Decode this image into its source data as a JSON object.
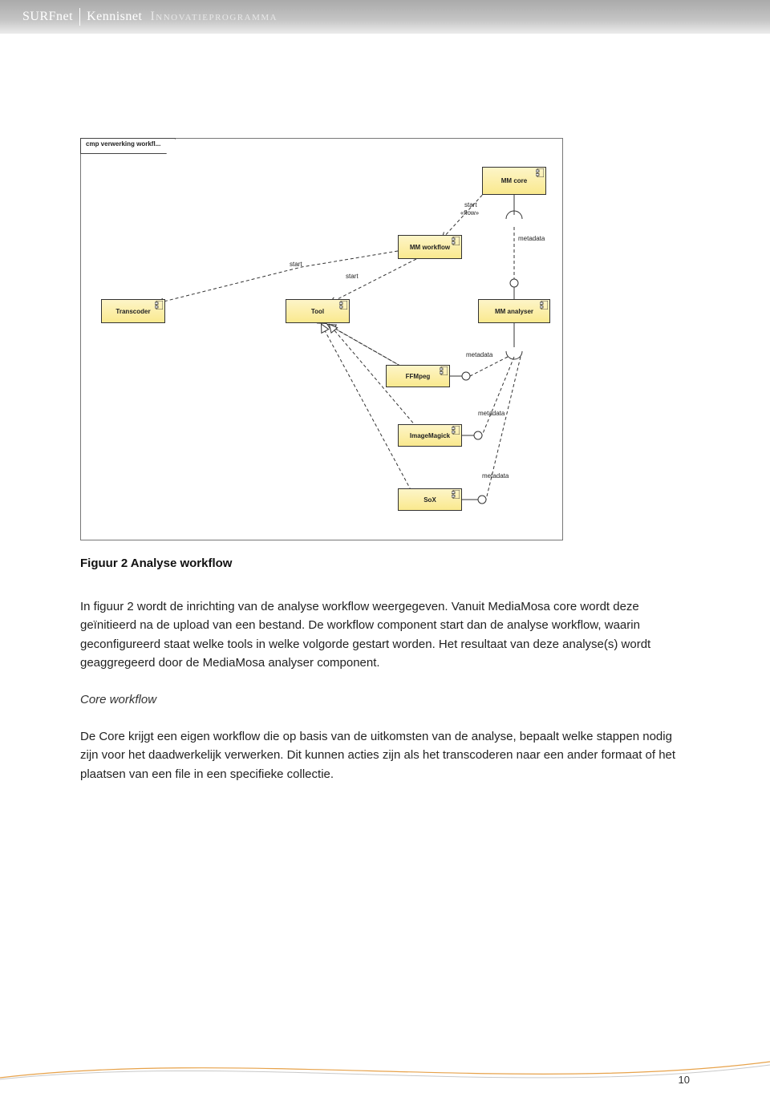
{
  "header": {
    "brand1": "SURFnet",
    "brand2": "Kennisnet",
    "program": "Innovatieprogramma"
  },
  "diagram": {
    "title_tab": "cmp verwerking workfl...",
    "components": {
      "mm_core": "MM core",
      "mm_workflow": "MM workflow",
      "transcoder": "Transcoder",
      "tool": "Tool",
      "mm_analyser": "MM analyser",
      "ffmpeg": "FFMpeg",
      "imagemagick": "ImageMagick",
      "sox": "SoX"
    },
    "labels": {
      "start_flow_1": "start",
      "start_flow_2": "«flow»",
      "start_a": "start",
      "start_b": "start",
      "metadata": "metadata"
    }
  },
  "body": {
    "caption": "Figuur 2 Analyse workflow",
    "para1": "In figuur 2 wordt de inrichting van de analyse workflow weergegeven. Vanuit MediaMosa core wordt deze geïnitieerd na de upload van een bestand. De workflow component start dan de analyse workflow, waarin geconfigureerd staat welke tools in welke volgorde gestart worden. Het resultaat van deze analyse(s) wordt geaggregeerd door de MediaMosa analyser component.",
    "sub1": "Core workflow",
    "para2": "De Core krijgt een eigen workflow die op basis van de uitkomsten van de analyse, bepaalt welke stappen nodig zijn voor het daadwerkelijk verwerken. Dit kunnen acties zijn als het transcoderen naar een ander formaat of het plaatsen van een file in een specifieke collectie."
  },
  "footer": {
    "page": "10"
  },
  "colors": {
    "component_gradient_top": "#fdf5c8",
    "component_gradient_bottom": "#fae98e",
    "header_gradient_top": "#aaaaaa",
    "header_gradient_bottom": "#ececec"
  }
}
